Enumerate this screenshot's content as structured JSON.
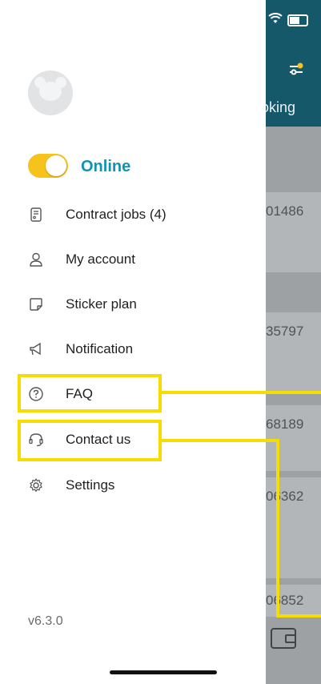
{
  "background": {
    "tab_label_partial": "oking",
    "cards": [
      "01486",
      "35797",
      "68189",
      "06362",
      "06852"
    ]
  },
  "drawer": {
    "status": {
      "label": "Online",
      "on": true
    },
    "menu": [
      {
        "label": "Contract jobs (4)",
        "icon": "contract-doc-icon"
      },
      {
        "label": "My account",
        "icon": "user-icon"
      },
      {
        "label": "Sticker plan",
        "icon": "sticker-icon"
      },
      {
        "label": "Notification",
        "icon": "megaphone-icon"
      },
      {
        "label": "FAQ",
        "icon": "question-circle-icon"
      },
      {
        "label": "Contact us",
        "icon": "headset-icon"
      },
      {
        "label": "Settings",
        "icon": "gear-icon"
      }
    ],
    "version": "v6.3.0"
  },
  "colors": {
    "accent_blue": "#1292b6",
    "toggle_yellow": "#f6c31c",
    "highlight_yellow": "#f7dc00",
    "header_teal": "#15586a"
  }
}
